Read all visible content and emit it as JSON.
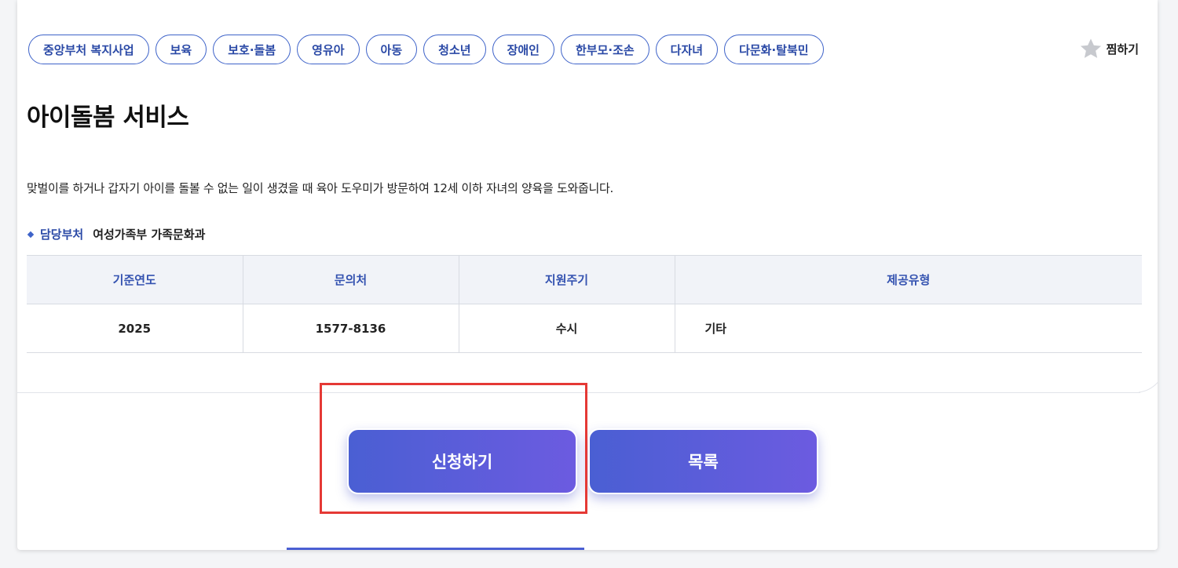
{
  "tags": [
    "중앙부처 복지사업",
    "보육",
    "보호·돌봄",
    "영유아",
    "아동",
    "청소년",
    "장애인",
    "한부모·조손",
    "다자녀",
    "다문화·탈북민"
  ],
  "favorite": {
    "label": "찜하기",
    "icon": "star-icon"
  },
  "title": "아이돌봄 서비스",
  "description": "맞벌이를 하거나 갑자기 아이를 돌볼 수 없는 일이 생겼을 때 육아 도우미가 방문하여 12세 이하 자녀의 양육을 도와줍니다.",
  "department": {
    "label": "담당부처",
    "value": "여성가족부 가족문화과"
  },
  "info_table": {
    "headers": [
      "기준연도",
      "문의처",
      "지원주기",
      "제공유형"
    ],
    "row": [
      "2025",
      "1577-8136",
      "수시",
      "기타"
    ]
  },
  "buttons": {
    "apply": "신청하기",
    "list": "목록"
  },
  "colors": {
    "accent": "#3e63c9",
    "button_start": "#4a5fd3",
    "button_end": "#6c5be0",
    "highlight": "#e53935"
  }
}
